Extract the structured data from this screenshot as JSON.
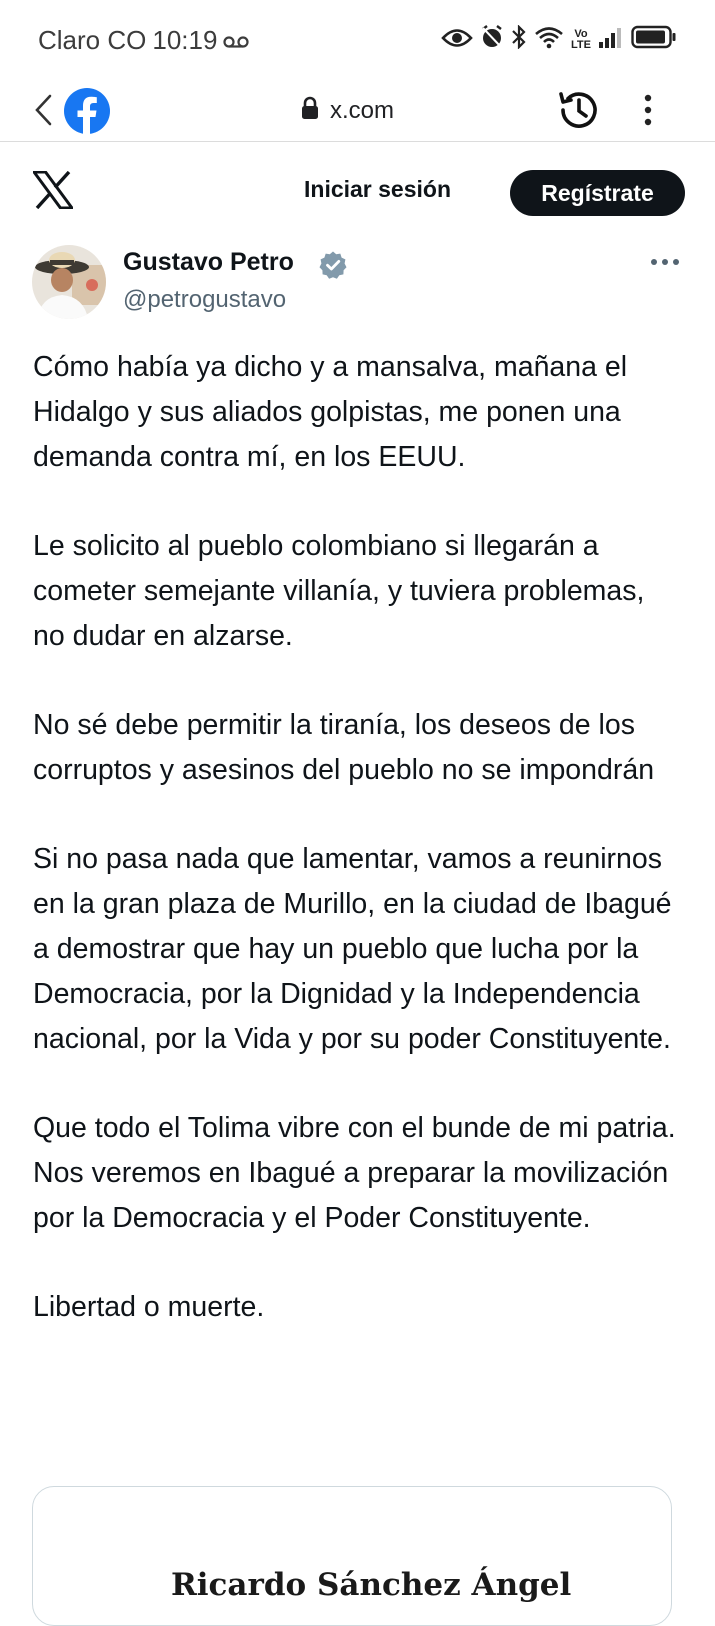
{
  "status_bar": {
    "carrier": "Claro CO",
    "time": "10:19",
    "network_label_top": "Vo",
    "network_label_bottom": "LTE"
  },
  "browser": {
    "url": "x.com"
  },
  "x_header": {
    "login_label": "Iniciar sesión",
    "register_label": "Regístrate"
  },
  "tweet": {
    "author_name": "Gustavo Petro",
    "author_handle": "@petrogustavo",
    "paragraphs": [
      "Cómo había ya dicho y a mansalva, mañana el Hidalgo y sus aliados golpistas, me ponen una demanda contra mí, en los EEUU.",
      "Le solicito al pueblo colombiano si llegarán a cometer semejante villanía, y tuviera problemas, no dudar en alzarse.",
      "No sé debe permitir la tiranía, los deseos de los corruptos y asesinos del pueblo no se impondrán",
      "Si no pasa nada que lamentar, vamos a reunirnos en la gran plaza de Murillo, en la ciudad de Ibagué a demostrar que hay un pueblo que lucha por la Democracia, por la Dignidad y la Independencia nacional, por la Vida y por su poder Constituyente.",
      "Que todo el Tolima vibre con el bunde de mi patria. Nos veremos en Ibagué a preparar la movilización por la Democracia y el Poder Constituyente.",
      "Libertad o muerte."
    ]
  },
  "quote_card": {
    "visible_text": "Ricardo Sánchez Ángel"
  },
  "colors": {
    "x_black": "#0f1419",
    "secondary_text": "#536471",
    "verified_gray": "#829aab",
    "facebook_blue": "#1877f2",
    "card_border": "#cfd9de"
  }
}
